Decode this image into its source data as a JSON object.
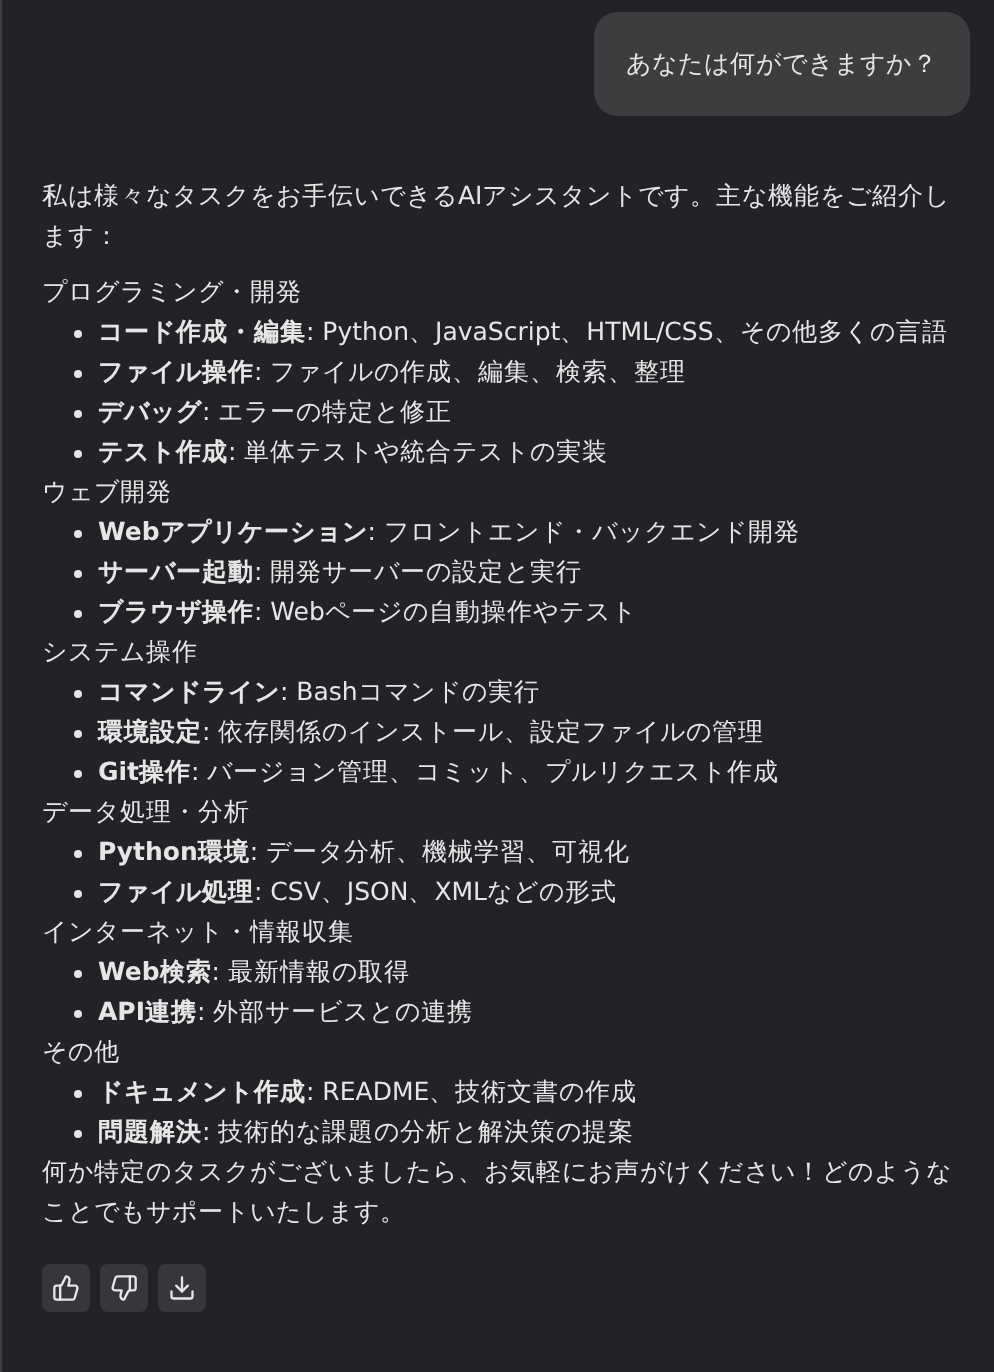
{
  "user_message": "あなたは何ができますか？",
  "reply": {
    "intro": "私は様々なタスクをお手伝いできるAIアシスタントです。主な機能をご紹介します：",
    "sections": [
      {
        "heading": "プログラミング・開発",
        "items": [
          "**コード作成・編集**: Python、JavaScript、HTML/CSS、その他多くの言語",
          "**ファイル操作**: ファイルの作成、編集、検索、整理",
          "**デバッグ**: エラーの特定と修正",
          "**テスト作成**: 単体テストや統合テストの実装"
        ]
      },
      {
        "heading": "ウェブ開発",
        "items": [
          "**Webアプリケーション**: フロントエンド・バックエンド開発",
          "**サーバー起動**: 開発サーバーの設定と実行",
          "**ブラウザ操作**: Webページの自動操作やテスト"
        ]
      },
      {
        "heading": "システム操作",
        "items": [
          "**コマンドライン**: Bashコマンドの実行",
          "**環境設定**: 依存関係のインストール、設定ファイルの管理",
          "**Git操作**: バージョン管理、コミット、プルリクエスト作成"
        ]
      },
      {
        "heading": "データ処理・分析",
        "items": [
          "**Python環境**: データ分析、機械学習、可視化",
          "**ファイル処理**: CSV、JSON、XMLなどの形式"
        ]
      },
      {
        "heading": "インターネット・情報収集",
        "items": [
          "**Web検索**: 最新情報の取得",
          "**API連携**: 外部サービスとの連携"
        ]
      },
      {
        "heading": "その他",
        "items": [
          "**ドキュメント作成**: README、技術文書の作成",
          "**問題解決**: 技術的な課題の分析と解決策の提案"
        ]
      }
    ],
    "closing": "何か特定のタスクがございましたら、お気軽にお声がけください！どのようなことでもサポートいたします。"
  },
  "actions": [
    {
      "kind": "like"
    },
    {
      "kind": "dislike"
    },
    {
      "kind": "download"
    }
  ]
}
